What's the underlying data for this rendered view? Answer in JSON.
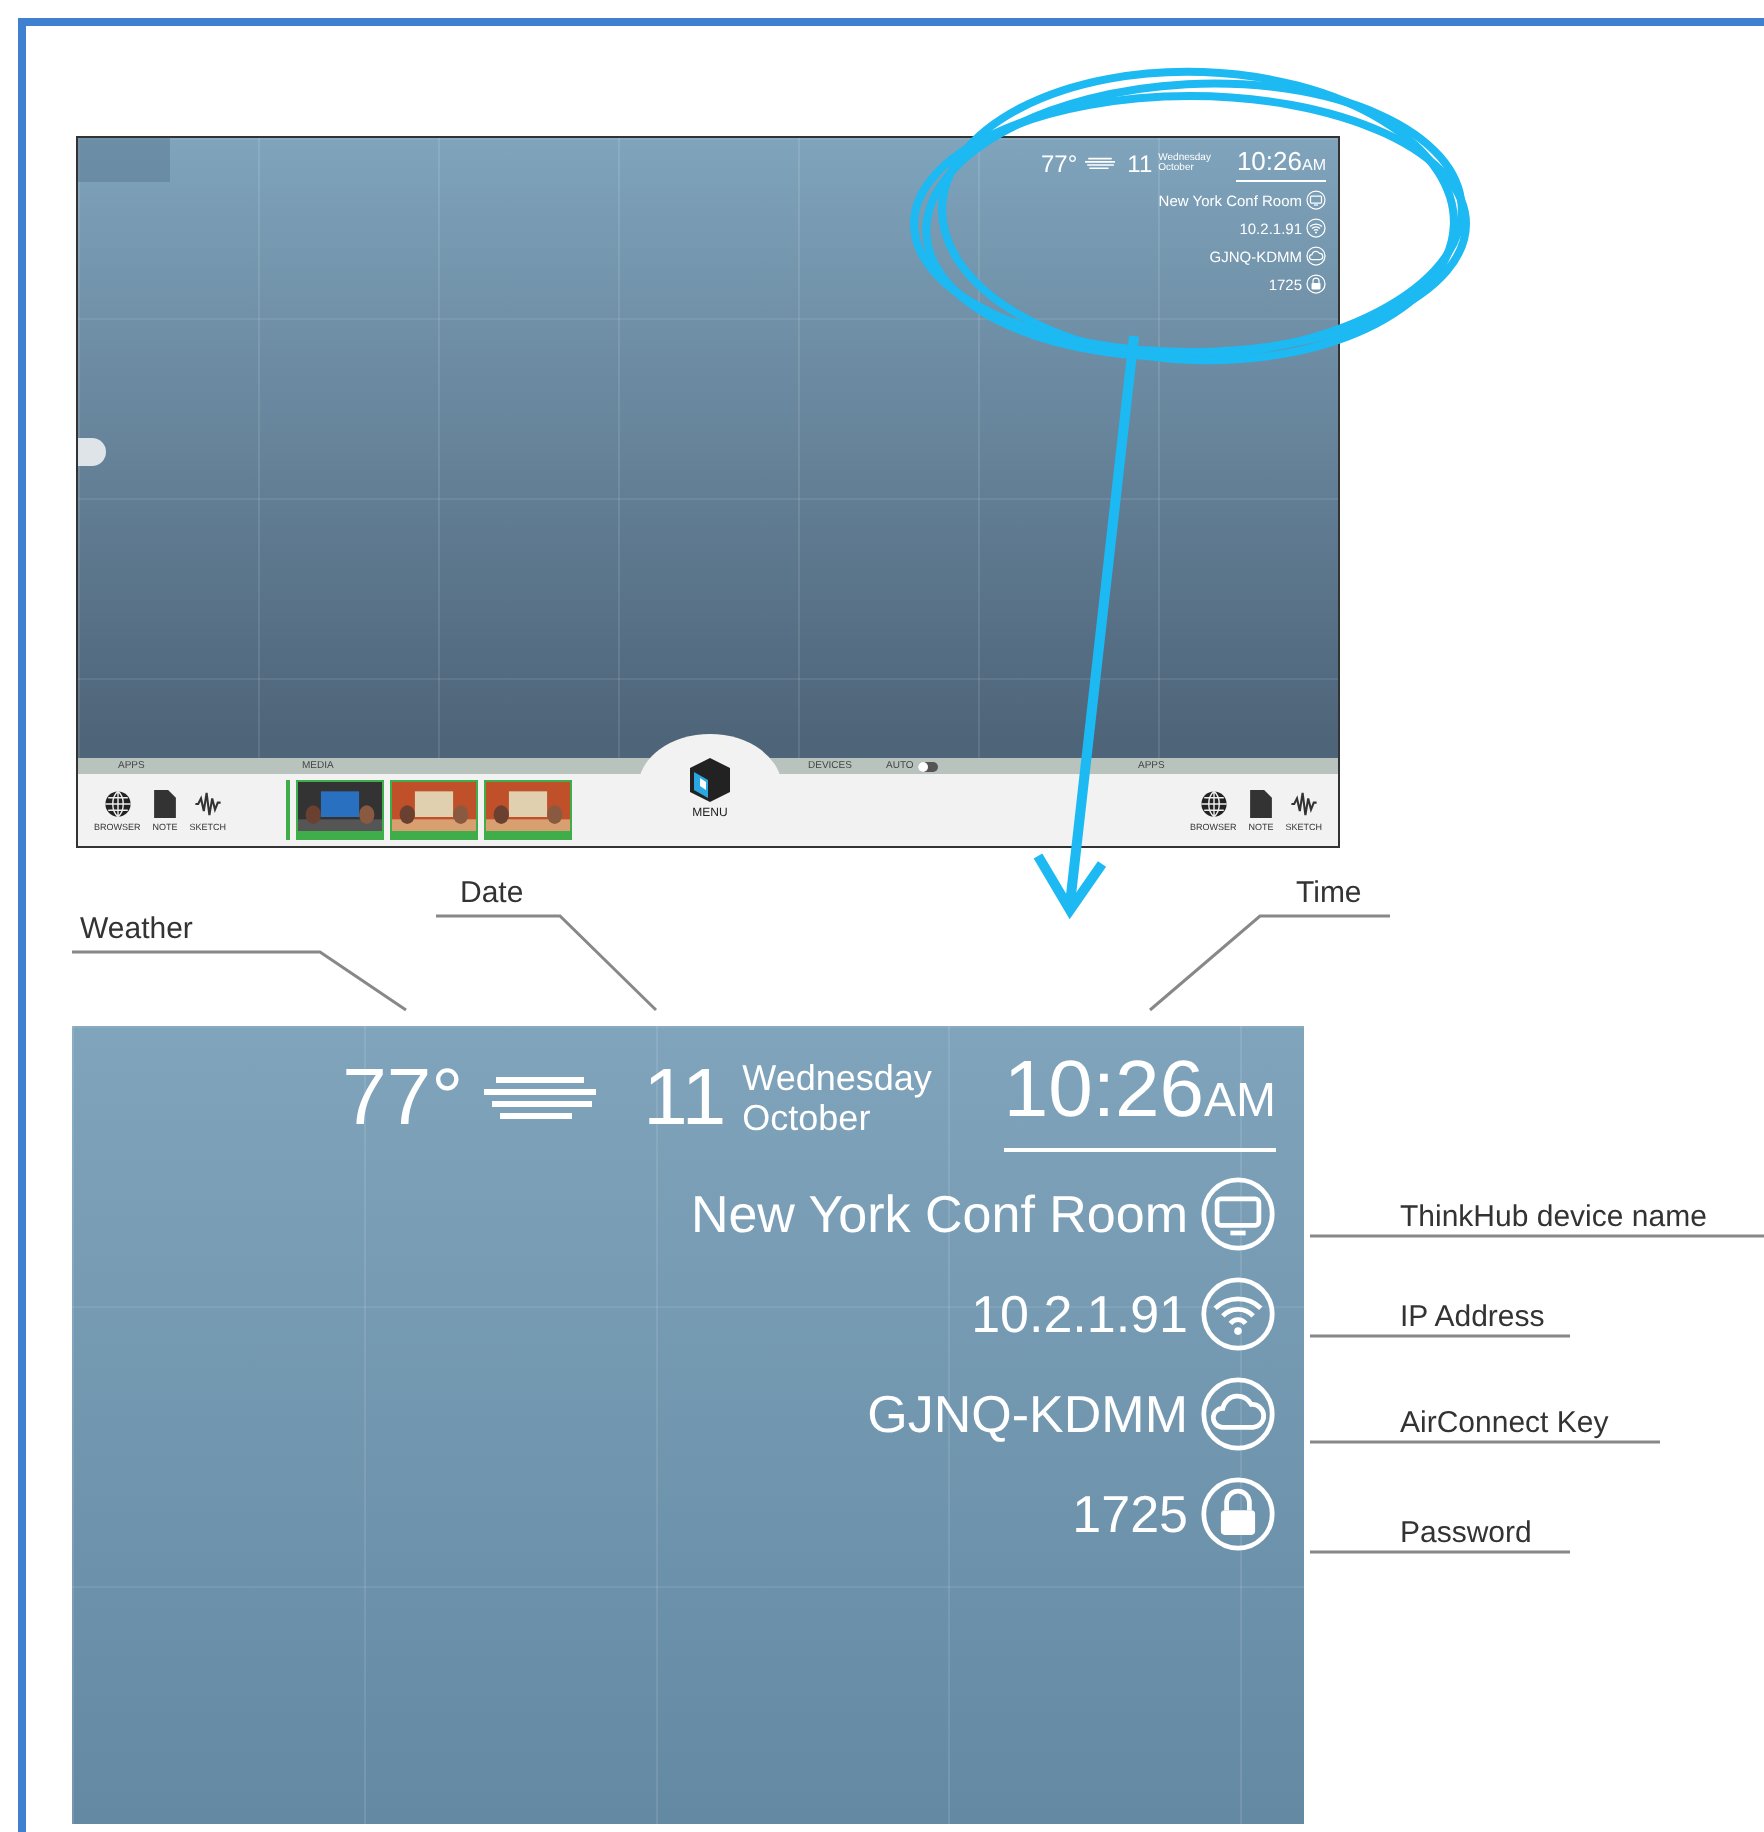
{
  "screenshot": {
    "weather": {
      "temperature": "77°"
    },
    "date": {
      "day": "11",
      "weekday": "Wednesday",
      "month": "October"
    },
    "time": {
      "clock": "10:26",
      "period": "AM"
    },
    "info_rows": [
      {
        "text": "New York Conf Room",
        "kind": "display"
      },
      {
        "text": "10.2.1.91",
        "kind": "wifi"
      },
      {
        "text": "GJNQ-KDMM",
        "kind": "cloud"
      },
      {
        "text": "1725",
        "kind": "lock"
      }
    ],
    "bottom_bar": {
      "left_heading": "APPS",
      "media_heading": "MEDIA",
      "devices_heading": "DEVICES",
      "auto_label": "AUTO",
      "auto_on": false,
      "right_heading": "APPS",
      "menu_label": "MENU",
      "apps_left": [
        {
          "label": "BROWSER",
          "kind": "globe"
        },
        {
          "label": "NOTE",
          "kind": "note"
        },
        {
          "label": "SKETCH",
          "kind": "sketch"
        }
      ],
      "apps_right": [
        {
          "label": "BROWSER",
          "kind": "globe"
        },
        {
          "label": "NOTE",
          "kind": "note"
        },
        {
          "label": "SKETCH",
          "kind": "sketch"
        }
      ]
    }
  },
  "zoomed_view": {
    "weather": {
      "temperature": "77°"
    },
    "date": {
      "day": "11",
      "weekday": "Wednesday",
      "month": "October"
    },
    "time": {
      "clock": "10:26",
      "period": "AM"
    },
    "info_rows": [
      {
        "text": "New York Conf Room",
        "kind": "display"
      },
      {
        "text": "10.2.1.91",
        "kind": "wifi"
      },
      {
        "text": "GJNQ-KDMM",
        "kind": "cloud"
      },
      {
        "text": "1725",
        "kind": "lock"
      }
    ]
  },
  "callouts": [
    {
      "label": "Weather",
      "kind": "weather"
    },
    {
      "label": "Date",
      "kind": "date"
    },
    {
      "label": "Time",
      "kind": "time"
    },
    {
      "label": "ThinkHub device name",
      "kind": "row"
    },
    {
      "label": "IP Address",
      "kind": "row"
    },
    {
      "label": "AirConnect Key",
      "kind": "row"
    },
    {
      "label": "Password",
      "kind": "row"
    }
  ]
}
